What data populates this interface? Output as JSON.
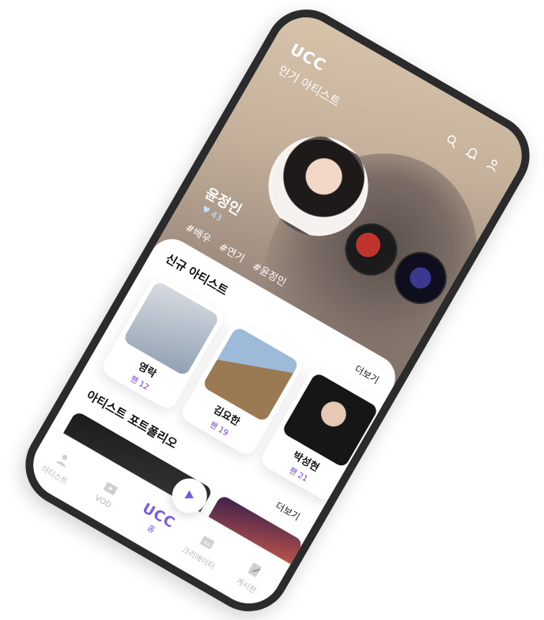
{
  "header": {
    "brand": "UCC",
    "section": "인기 아티스트"
  },
  "featured": {
    "name": "윤정인",
    "fans": "♥ 43",
    "tags": [
      "#배우",
      "#연기",
      "#윤정인"
    ]
  },
  "new_artists": {
    "title": "신규 아티스트",
    "more": "더보기",
    "items": [
      {
        "name": "영락",
        "fans": "팬 12"
      },
      {
        "name": "김요한",
        "fans": "팬 19"
      },
      {
        "name": "박성현",
        "fans": "팬 21"
      }
    ]
  },
  "portfolio": {
    "title": "아티스트 포트폴리오",
    "more": "더보기"
  },
  "tabs": [
    {
      "label": "아티스트",
      "icon": "person-icon"
    },
    {
      "label": "VOD",
      "icon": "play-box-icon"
    },
    {
      "brand": "UCC",
      "label": "홈",
      "icon": "play-icon"
    },
    {
      "label": "크리에이터",
      "icon": "ad-icon"
    },
    {
      "label": "게시판",
      "icon": "edit-icon"
    }
  ],
  "colors": {
    "accent": "#7a5ae8",
    "highlight": "#6fe3e0",
    "fan_text": "#7a38e6"
  }
}
